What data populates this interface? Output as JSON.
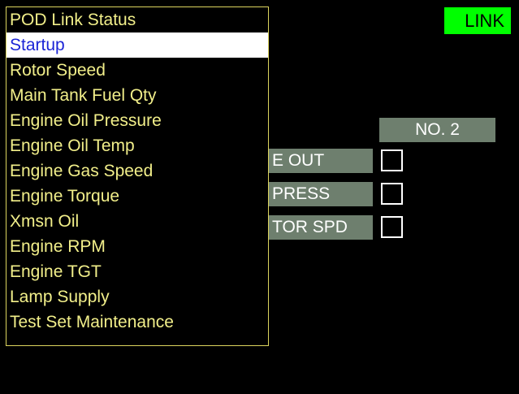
{
  "link_indicator": {
    "label": "LINK",
    "color": "#00ff00"
  },
  "column_header": {
    "label": "NO. 2"
  },
  "status_rows": [
    {
      "label": "E OUT",
      "checked": false
    },
    {
      "label": "PRESS",
      "checked": false
    },
    {
      "label": "TOR SPD",
      "checked": false
    }
  ],
  "menu": {
    "selected_index": 1,
    "items": [
      "POD Link Status",
      "Startup",
      "Rotor Speed",
      "Main Tank Fuel Qty",
      "Engine Oil Pressure",
      "Engine Oil Temp",
      "Engine Gas Speed",
      "Engine Torque",
      "Xmsn Oil",
      "Engine RPM",
      "Engine TGT",
      "Lamp Supply",
      "Test Set Maintenance"
    ]
  },
  "colors": {
    "background": "#000000",
    "menu_text": "#f2ef8a",
    "menu_border": "#dcd45e",
    "selected_bg": "#ffffff",
    "selected_text": "#1b24d6",
    "panel_gray": "#6e7f6e"
  }
}
